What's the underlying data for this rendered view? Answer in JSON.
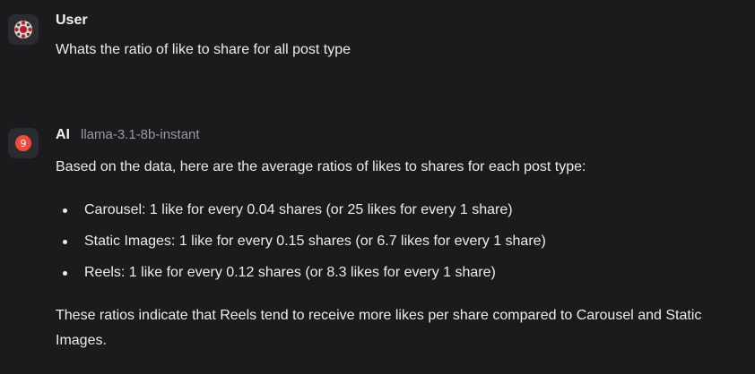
{
  "user_message": {
    "sender": "User",
    "avatar_icon": "user-avatar-icon",
    "text": "Whats the ratio of like to share for all post type"
  },
  "ai_message": {
    "sender": "AI",
    "badge": "9",
    "model": "llama-3.1-8b-instant",
    "intro": "Based on the data, here are the average ratios of likes to shares for each post type:",
    "items": [
      "Carousel: 1 like for every 0.04 shares (or 25 likes for every 1 share)",
      "Static Images: 1 like for every 0.15 shares (or 6.7 likes for every 1 share)",
      "Reels: 1 like for every 0.12 shares (or 8.3 likes for every 1 share)"
    ],
    "conclusion": "These ratios indicate that Reels tend to receive more likes per share compared to Carousel and Static Images."
  },
  "colors": {
    "background": "#1b1b1d",
    "text": "#ececec",
    "muted": "#9a9a9f",
    "badge": "#f04b3a"
  }
}
